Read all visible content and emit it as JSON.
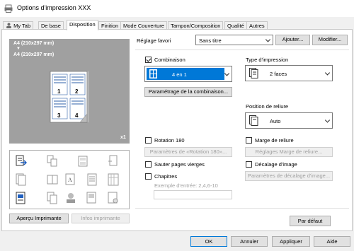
{
  "window": {
    "title": "Options d'impression XXX"
  },
  "tabs": [
    "My Tab",
    "De base",
    "Disposition",
    "Finition",
    "Mode Couverture",
    "Tampon/Composition",
    "Qualité",
    "Autres"
  ],
  "preview": {
    "size1": "A4 (210x297 mm)",
    "arrow": "▼",
    "size2": "A4 (210x297 mm)",
    "copies": "x1",
    "pages": [
      "1",
      "2",
      "3",
      "4"
    ]
  },
  "favorites": {
    "label": "Réglage favori",
    "value": "Sans titre",
    "add": "Ajouter...",
    "edit": "Modifier..."
  },
  "combine": {
    "label": "Combinaison",
    "value": "4 en 1",
    "settings": "Paramétrage de la combinaison..."
  },
  "print_type": {
    "label": "Type d'impression",
    "value": "2 faces"
  },
  "binding": {
    "label": "Position de reliure",
    "value": "Auto"
  },
  "rotate": {
    "label": "Rotation 180",
    "settings": "Paramètres de «Rotation 180»..."
  },
  "skip_blank": {
    "label": "Sauter pages vierges"
  },
  "chapters": {
    "label": "Chapitres",
    "example": "Exemple d'entrée: 2,4,6-10"
  },
  "binding_margin": {
    "label": "Marge de reliure",
    "settings": "Réglages Marge de reliure..."
  },
  "image_shift": {
    "label": "Décalage d'image",
    "settings": "Paramètres de décalage d'image..."
  },
  "bottom_left": {
    "printer_view": "Aperçu Imprimante",
    "printer_info": "Infos imprimante"
  },
  "default_button": "Par défaut",
  "dialog": {
    "ok": "OK",
    "cancel": "Annuler",
    "apply": "Appliquer",
    "help": "Aide"
  }
}
